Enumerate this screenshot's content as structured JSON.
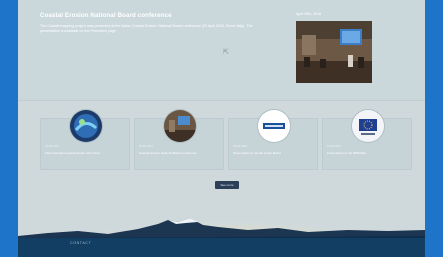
{
  "feature": {
    "title": "Coastal Erosion National Board conference",
    "body": "The Coastal mapping project was presented at the Italian Coastal Erosion National Board conference (20 April 2016, Rome Italy). The presentation is available on the Promotion page.",
    "date": "April 20th, 2016"
  },
  "cards": [
    {
      "date": "29 Apr 2016",
      "title": "Field operations questionnaire still online!"
    },
    {
      "date": "20 Apr 2016",
      "title": "Coastal Erosion National Board conference"
    },
    {
      "date": "18 Apr 2016",
      "title": "Presentation to the EC Coast Board"
    },
    {
      "date": "11 Apr 2016",
      "title": "Presentation to the RPRGEG"
    }
  ],
  "see_more_label": "See more",
  "footer": {
    "contact_label": "CONTACT"
  },
  "colors": {
    "outer_frame": "#1d74c8",
    "footer_bar": "#123e63",
    "button": "#2b3f59"
  }
}
